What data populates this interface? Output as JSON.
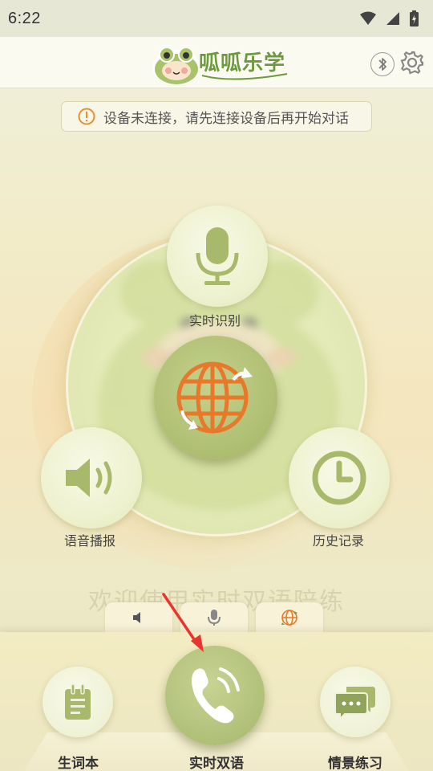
{
  "status_bar": {
    "time": "6:22"
  },
  "header": {
    "logo_text": "呱呱乐学"
  },
  "notice": {
    "text": "设备未连接，请先连接设备后再开始对话"
  },
  "features": {
    "realtime_recognition": "实时识别",
    "voice_broadcast": "语音播报",
    "history": "历史记录"
  },
  "welcome": {
    "text": "欢迎使用实时双语陪练"
  },
  "bottom_nav": {
    "vocabulary": "生词本",
    "realtime_bilingual": "实时双语",
    "scenario_practice": "情景练习"
  },
  "colors": {
    "accent_green": "#9fb266",
    "globe_orange": "#e8782a",
    "icon_green": "#a9b96c",
    "arrow_red": "#e8342f"
  },
  "icons": [
    "wifi-icon",
    "signal-icon",
    "battery-icon",
    "bluetooth-icon",
    "gear-icon",
    "info-icon",
    "microphone-icon",
    "speaker-icon",
    "clock-icon",
    "globe-icon",
    "notebook-icon",
    "phone-icon",
    "chat-icon"
  ]
}
